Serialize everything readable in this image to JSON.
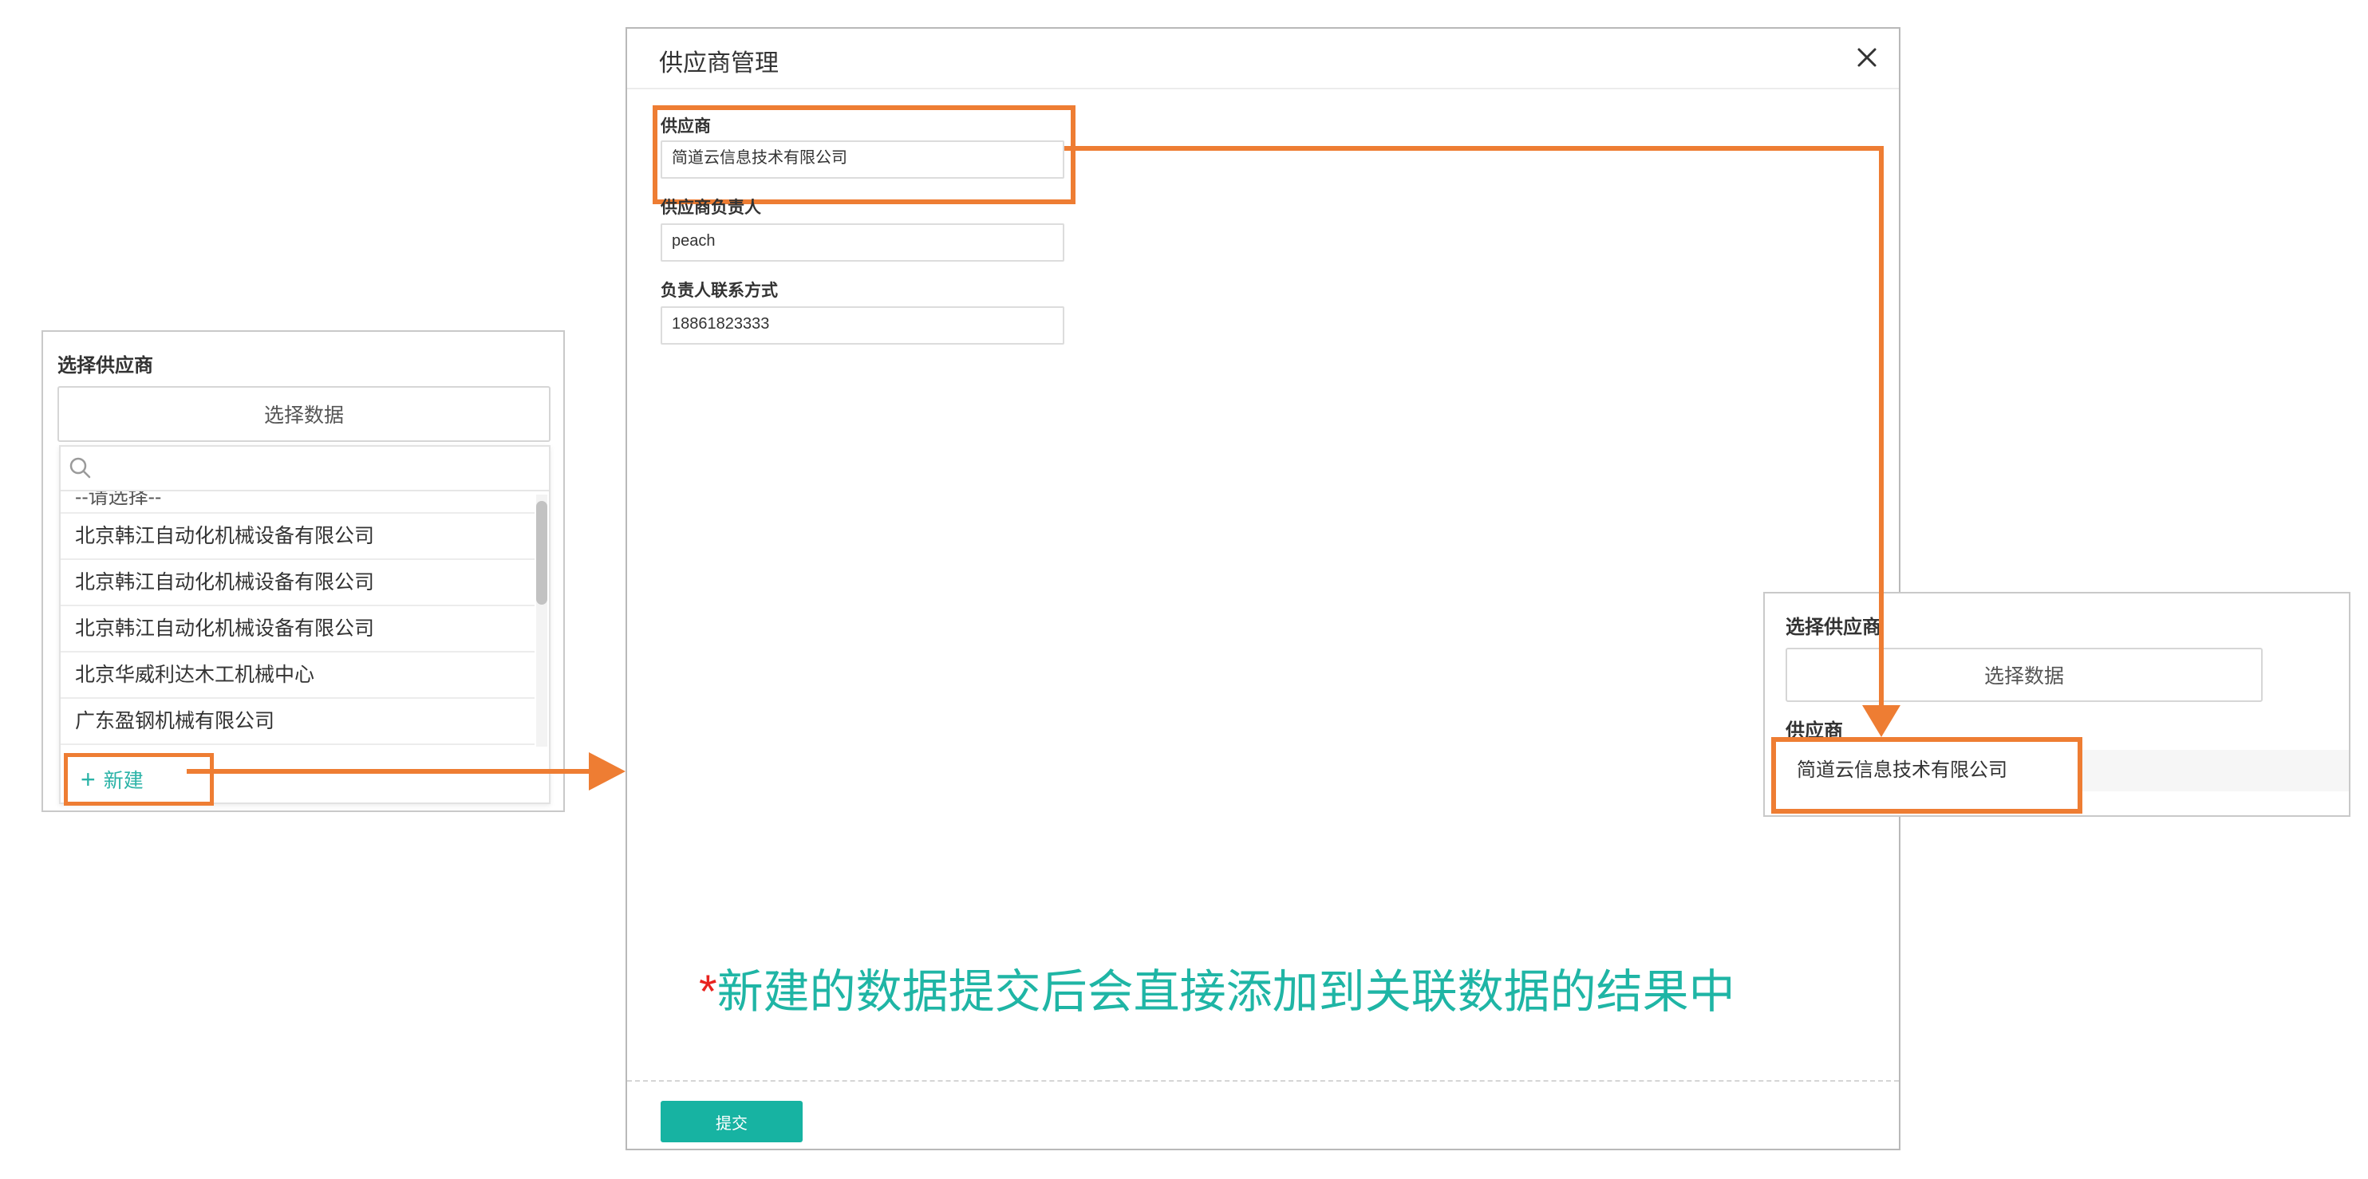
{
  "left_panel": {
    "title": "选择供应商",
    "select_button": "选择数据",
    "dropdown": {
      "search_placeholder": "",
      "items": [
        "--请选择--",
        "北京韩江自动化机械设备有限公司",
        "北京韩江自动化机械设备有限公司",
        "北京韩江自动化机械设备有限公司",
        "北京华威利达木工机械中心",
        "广东盈钢机械有限公司"
      ],
      "new_button": "新建",
      "new_icon": "plus-icon"
    }
  },
  "modal": {
    "title": "供应商管理",
    "close_icon": "close-icon",
    "fields": {
      "supplier_label": "供应商",
      "supplier_value": "简道云信息技术有限公司",
      "contact_person_label": "供应商负责人",
      "contact_person_value": "peach",
      "contact_info_label": "负责人联系方式",
      "contact_info_value": "18861823333"
    },
    "note_star": "*",
    "note_text": "新建的数据提交后会直接添加到关联数据的结果中",
    "submit_button": "提交"
  },
  "right_panel": {
    "title": "选择供应商",
    "select_button": "选择数据",
    "supplier_label": "供应商",
    "supplier_value": "简道云信息技术有限公司"
  },
  "colors": {
    "highlight": "#ee7d33",
    "accent_teal": "#17b3a2",
    "note_teal": "#1fb5a5",
    "note_star_red": "#e8231f"
  }
}
